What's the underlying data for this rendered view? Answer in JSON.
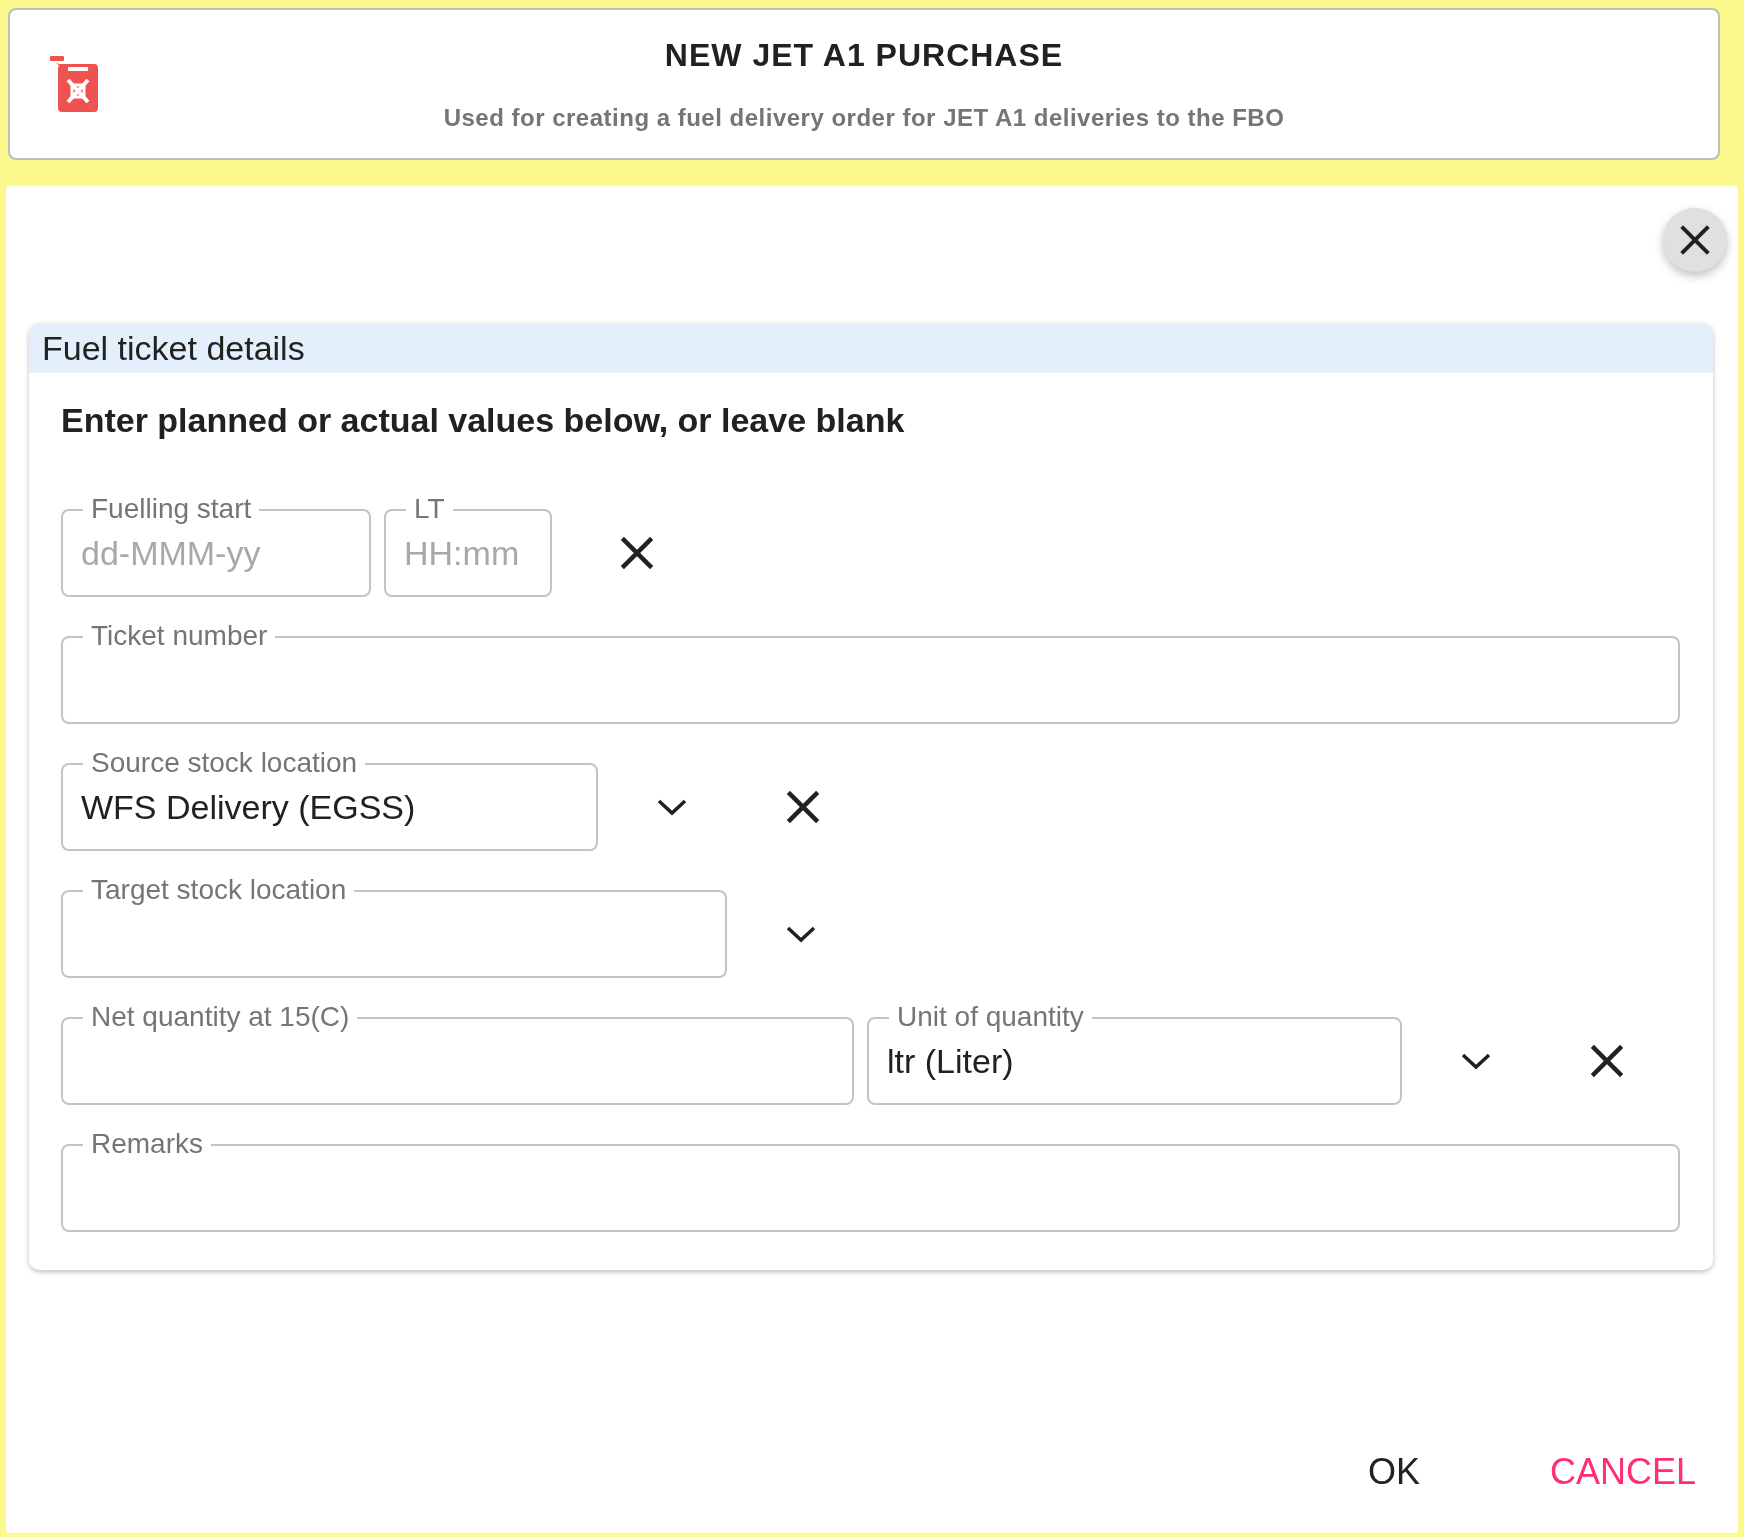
{
  "header": {
    "title": "NEW JET A1 PURCHASE",
    "subtitle": "Used for creating a fuel delivery order for JET A1 deliveries to the FBO"
  },
  "card": {
    "title": "Fuel ticket details",
    "instruction": "Enter planned or actual values below, or leave blank",
    "rows": [
      {
        "fields": [
          {
            "label": "Fuelling start",
            "placeholder": "dd-MMM-yy"
          },
          {
            "label": "LT",
            "placeholder": "HH:mm"
          }
        ],
        "dropdown": false,
        "clear": true
      },
      {
        "fields": [
          {
            "label": "Ticket number"
          }
        ],
        "dropdown": false,
        "clear": false
      },
      {
        "fields": [
          {
            "label": "Source stock location",
            "value": "WFS Delivery (EGSS)"
          }
        ],
        "dropdown": true,
        "clear": true
      },
      {
        "fields": [
          {
            "label": "Target stock location"
          }
        ],
        "dropdown": true,
        "clear": false
      },
      {
        "fields": [
          {
            "label": "Net quantity at 15(C)"
          },
          {
            "label": "Unit of quantity",
            "value": "ltr (Liter)"
          }
        ],
        "dropdown": true,
        "clear": true
      },
      {
        "fields": [
          {
            "label": "Remarks"
          }
        ],
        "dropdown": false,
        "clear": false
      }
    ]
  },
  "buttons": [
    {
      "label": "OK",
      "kind": "primary"
    },
    {
      "label": "CANCEL",
      "kind": "cancel"
    }
  ]
}
